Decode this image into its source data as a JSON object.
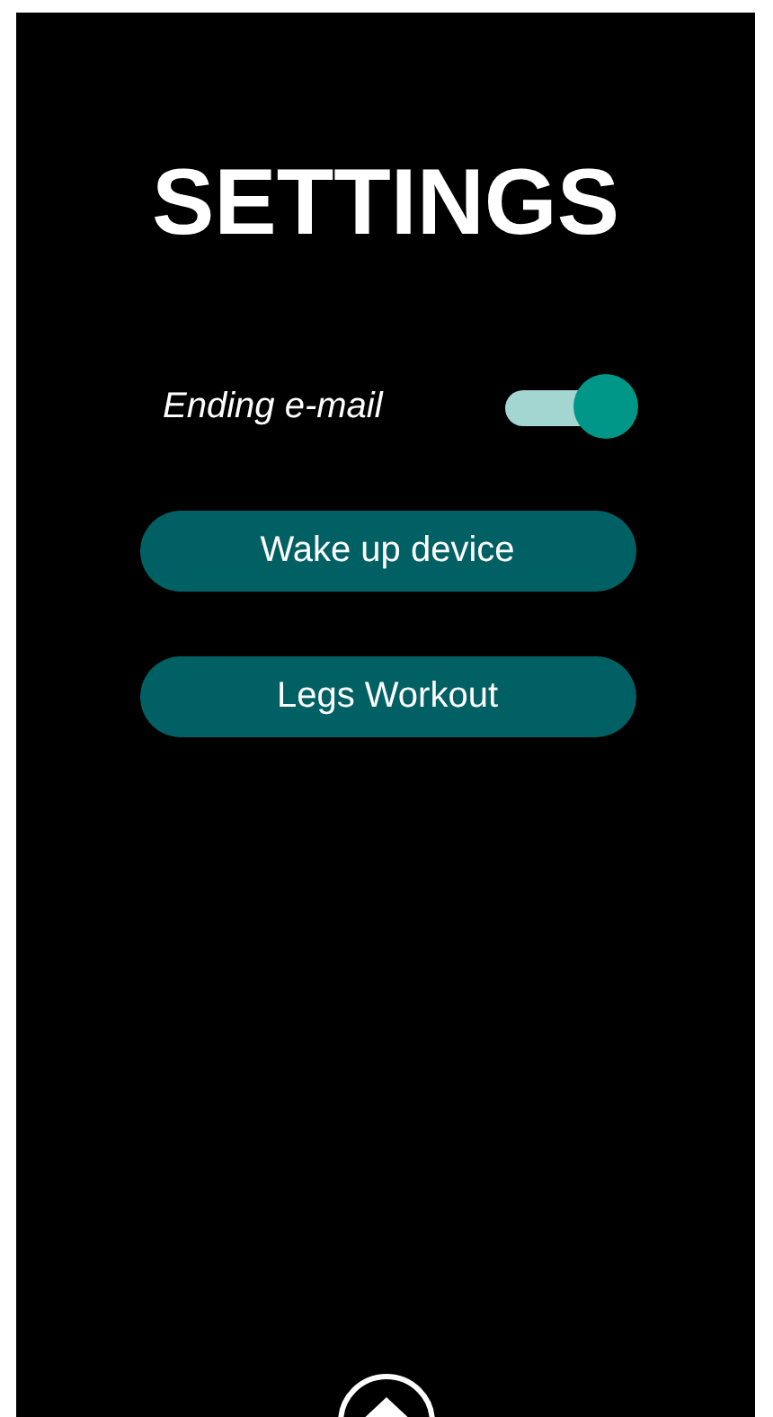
{
  "title": "SETTINGS",
  "settings": [
    {
      "label": "Ending e-mail",
      "on": true
    }
  ],
  "buttons": [
    "Wake up device",
    "Legs Workout"
  ]
}
